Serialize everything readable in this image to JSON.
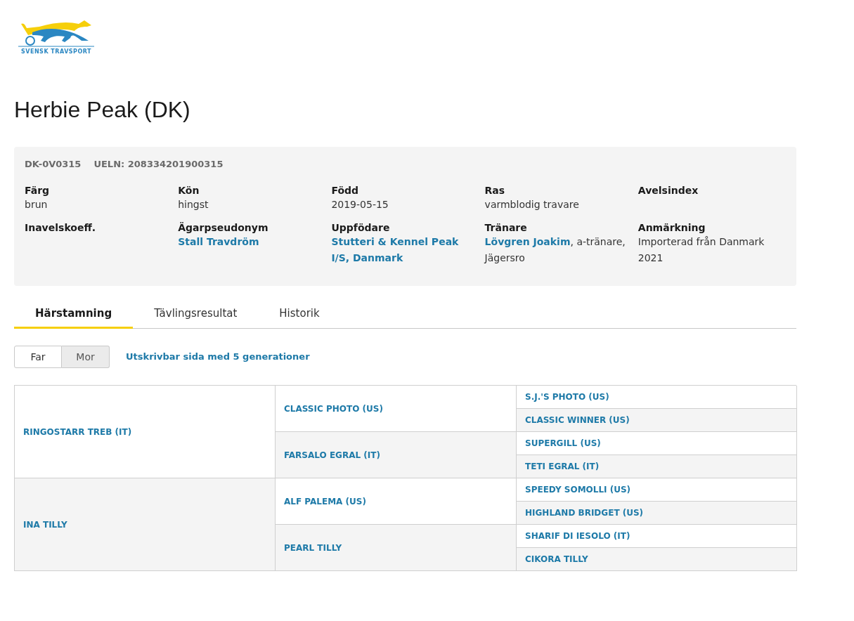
{
  "logo": {
    "text": "SVENSK TRAVSPORT"
  },
  "title": "Herbie Peak (DK)",
  "ids": [
    "DK-0V0315",
    "UELN: 208334201900315"
  ],
  "fields": [
    {
      "label": "Färg",
      "kind": "text",
      "value": "brun"
    },
    {
      "label": "Kön",
      "kind": "text",
      "value": "hingst"
    },
    {
      "label": "Född",
      "kind": "text",
      "value": "2019-05-15"
    },
    {
      "label": "Ras",
      "kind": "text",
      "value": "varmblodig travare"
    },
    {
      "label": "Avelsindex",
      "kind": "empty"
    },
    {
      "label": "Inavelskoeff.",
      "kind": "empty"
    },
    {
      "label": "Ägarpseudonym",
      "kind": "link",
      "value": "Stall Travdröm"
    },
    {
      "label": "Uppfödare",
      "kind": "link",
      "value": "Stutteri & Kennel Peak I/S, Danmark"
    },
    {
      "label": "Tränare",
      "kind": "mixed",
      "link": "Lövgren Joakim",
      "value": ", a-tränare, Jägersro"
    },
    {
      "label": "Anmärkning",
      "kind": "text",
      "value": "Importerad från Danmark 2021"
    }
  ],
  "tabs": [
    {
      "label": "Härstamning",
      "selected": true
    },
    {
      "label": "Tävlingsresultat",
      "selected": false
    },
    {
      "label": "Historik",
      "selected": false
    }
  ],
  "toggle": [
    {
      "label": "Far",
      "selected": true
    },
    {
      "label": "Mor",
      "selected": false
    }
  ],
  "print_link": "Utskrivbar sida med 5 generationer",
  "pedigree": [
    {
      "name": "RINGOSTARR TREB (IT)",
      "children": [
        {
          "name": "CLASSIC PHOTO (US)",
          "children": [
            {
              "name": "S.J.'S PHOTO (US)"
            },
            {
              "name": "CLASSIC WINNER (US)"
            }
          ]
        },
        {
          "name": "FARSALO EGRAL (IT)",
          "children": [
            {
              "name": "SUPERGILL (US)"
            },
            {
              "name": "TETI EGRAL (IT)"
            }
          ]
        }
      ]
    },
    {
      "name": "INA TILLY",
      "children": [
        {
          "name": "ALF PALEMA (US)",
          "children": [
            {
              "name": "SPEEDY SOMOLLI (US)"
            },
            {
              "name": "HIGHLAND BRIDGET (US)"
            }
          ]
        },
        {
          "name": "PEARL TILLY",
          "children": [
            {
              "name": "SHARIF DI IESOLO (IT)"
            },
            {
              "name": "CIKORA TILLY"
            }
          ]
        }
      ]
    }
  ]
}
